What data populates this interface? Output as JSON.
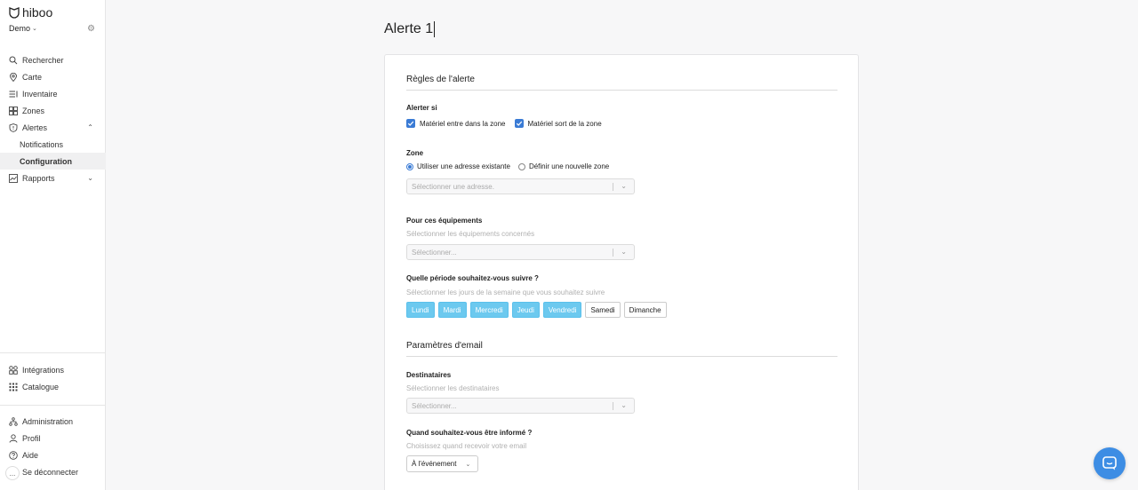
{
  "sidebar": {
    "logo_text": "hiboo",
    "org_name": "Demo",
    "nav": [
      {
        "label": "Rechercher",
        "icon": "search-icon"
      },
      {
        "label": "Carte",
        "icon": "map-pin-icon"
      },
      {
        "label": "Inventaire",
        "icon": "list-icon"
      },
      {
        "label": "Zones",
        "icon": "grid-icon"
      },
      {
        "label": "Alertes",
        "icon": "alert-shield-icon"
      },
      {
        "label": "Notifications"
      },
      {
        "label": "Configuration"
      },
      {
        "label": "Rapports",
        "icon": "chart-icon"
      }
    ],
    "bottom_nav": [
      {
        "label": "Intégrations",
        "icon": "integrations-icon"
      },
      {
        "label": "Catalogue",
        "icon": "catalog-icon"
      }
    ],
    "account_nav": [
      {
        "label": "Administration",
        "icon": "admin-icon"
      },
      {
        "label": "Profil",
        "icon": "user-icon"
      },
      {
        "label": "Aide",
        "icon": "help-icon"
      },
      {
        "label": "Se déconnecter",
        "icon": "logout-icon"
      }
    ],
    "more_label": "..."
  },
  "main": {
    "title": "Alerte 1",
    "rules_section": {
      "title": "Règles de l'alerte",
      "alert_if_label": "Alerter si",
      "checks": [
        "Matériel entre dans la zone",
        "Matériel sort de la zone"
      ],
      "zone_label": "Zone",
      "radios": [
        "Utiliser une adresse existante",
        "Définir une nouvelle zone"
      ],
      "address_placeholder": "Sélectionner une adresse.",
      "equipment_label": "Pour ces équipements",
      "equipment_hint": "Sélectionner les équipements concernés",
      "equipment_placeholder": "Sélectionner...",
      "period_label": "Quelle période souhaitez-vous suivre ?",
      "period_hint": "Sélectionner les jours de la semaine que vous souhaitez suivre",
      "days": [
        {
          "label": "Lundi",
          "selected": true
        },
        {
          "label": "Mardi",
          "selected": true
        },
        {
          "label": "Mercredi",
          "selected": true
        },
        {
          "label": "Jeudi",
          "selected": true
        },
        {
          "label": "Vendredi",
          "selected": true
        },
        {
          "label": "Samedi",
          "selected": false
        },
        {
          "label": "Dimanche",
          "selected": false
        }
      ]
    },
    "email_section": {
      "title": "Paramètres d'email",
      "recipients_label": "Destinataires",
      "recipients_hint": "Sélectionner les destinataires",
      "recipients_placeholder": "Sélectionner...",
      "when_label": "Quand souhaitez-vous être informé ?",
      "when_hint": "Choisissez quand recevoir votre email",
      "when_value": "À l'événement"
    }
  },
  "colors": {
    "accent": "#3a7bd5",
    "day_selected": "#6cc9ef",
    "chat": "#3d8de4"
  }
}
